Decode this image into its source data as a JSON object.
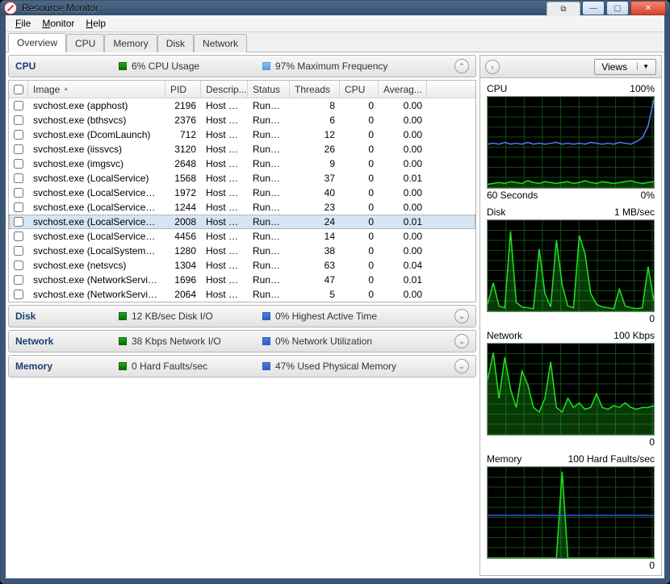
{
  "window": {
    "title": "Resource Monitor"
  },
  "menu": {
    "file": "File",
    "monitor": "Monitor",
    "help": "Help"
  },
  "tabs": [
    "Overview",
    "CPU",
    "Memory",
    "Disk",
    "Network"
  ],
  "active_tab": 0,
  "sections": {
    "cpu": {
      "name": "CPU",
      "m1": "6% CPU Usage",
      "m2": "97% Maximum Frequency",
      "expanded": true
    },
    "disk": {
      "name": "Disk",
      "m1": "12 KB/sec Disk I/O",
      "m2": "0% Highest Active Time",
      "expanded": false
    },
    "network": {
      "name": "Network",
      "m1": "38 Kbps Network I/O",
      "m2": "0% Network Utilization",
      "expanded": false
    },
    "memory": {
      "name": "Memory",
      "m1": "0 Hard Faults/sec",
      "m2": "47% Used Physical Memory",
      "expanded": false
    }
  },
  "columns": [
    "Image",
    "PID",
    "Descrip...",
    "Status",
    "Threads",
    "CPU",
    "Averag..."
  ],
  "processes": [
    {
      "image": "svchost.exe (apphost)",
      "pid": 2196,
      "desc": "Host Pr...",
      "status": "Runni...",
      "threads": 8,
      "cpu": 0,
      "avg": "0.00"
    },
    {
      "image": "svchost.exe (bthsvcs)",
      "pid": 2376,
      "desc": "Host Pr...",
      "status": "Runni...",
      "threads": 6,
      "cpu": 0,
      "avg": "0.00"
    },
    {
      "image": "svchost.exe (DcomLaunch)",
      "pid": 712,
      "desc": "Host Pr...",
      "status": "Runni...",
      "threads": 12,
      "cpu": 0,
      "avg": "0.00"
    },
    {
      "image": "svchost.exe (iissvcs)",
      "pid": 3120,
      "desc": "Host Pr...",
      "status": "Runni...",
      "threads": 26,
      "cpu": 0,
      "avg": "0.00"
    },
    {
      "image": "svchost.exe (imgsvc)",
      "pid": 2648,
      "desc": "Host Pr...",
      "status": "Runni...",
      "threads": 9,
      "cpu": 0,
      "avg": "0.00"
    },
    {
      "image": "svchost.exe (LocalService)",
      "pid": 1568,
      "desc": "Host Pr...",
      "status": "Runni...",
      "threads": 37,
      "cpu": 0,
      "avg": "0.01"
    },
    {
      "image": "svchost.exe (LocalServiceAn...",
      "pid": 1972,
      "desc": "Host Pr...",
      "status": "Runni...",
      "threads": 40,
      "cpu": 0,
      "avg": "0.00"
    },
    {
      "image": "svchost.exe (LocalServiceNet...",
      "pid": 1244,
      "desc": "Host Pr...",
      "status": "Runni...",
      "threads": 23,
      "cpu": 0,
      "avg": "0.00"
    },
    {
      "image": "svchost.exe (LocalServiceNo...",
      "pid": 2008,
      "desc": "Host Pr...",
      "status": "Runni...",
      "threads": 24,
      "cpu": 0,
      "avg": "0.01",
      "selected": true
    },
    {
      "image": "svchost.exe (LocalServicePee...",
      "pid": 4456,
      "desc": "Host Pr...",
      "status": "Runni...",
      "threads": 14,
      "cpu": 0,
      "avg": "0.00"
    },
    {
      "image": "svchost.exe (LocalSystemNet...",
      "pid": 1280,
      "desc": "Host Pr...",
      "status": "Runni...",
      "threads": 38,
      "cpu": 0,
      "avg": "0.00"
    },
    {
      "image": "svchost.exe (netsvcs)",
      "pid": 1304,
      "desc": "Host Pr...",
      "status": "Runni...",
      "threads": 63,
      "cpu": 0,
      "avg": "0.04"
    },
    {
      "image": "svchost.exe (NetworkService)",
      "pid": 1696,
      "desc": "Host Pr...",
      "status": "Runni...",
      "threads": 47,
      "cpu": 0,
      "avg": "0.01"
    },
    {
      "image": "svchost.exe (NetworkService...",
      "pid": 2064,
      "desc": "Host Pr...",
      "status": "Runni...",
      "threads": 5,
      "cpu": 0,
      "avg": "0.00"
    }
  ],
  "right": {
    "views": "Views",
    "graphs": [
      {
        "title": "CPU",
        "right": "100%",
        "footer_l": "60 Seconds",
        "footer_r": "0%"
      },
      {
        "title": "Disk",
        "right": "1 MB/sec",
        "footer_l": "",
        "footer_r": "0"
      },
      {
        "title": "Network",
        "right": "100 Kbps",
        "footer_l": "",
        "footer_r": "0"
      },
      {
        "title": "Memory",
        "right": "100 Hard Faults/sec",
        "footer_l": "",
        "footer_r": "0"
      }
    ]
  },
  "chart_data": [
    {
      "type": "line",
      "title": "CPU",
      "ylim": [
        0,
        100
      ],
      "xlabel": "60 Seconds",
      "ylabel": "%",
      "series": [
        {
          "name": "CPU Usage",
          "color": "#1fe01f",
          "values": [
            4,
            5,
            6,
            5,
            7,
            6,
            5,
            8,
            6,
            5,
            7,
            6,
            5,
            6,
            7,
            5,
            6,
            8,
            6,
            5,
            7,
            6,
            5,
            6,
            7,
            8,
            6,
            5,
            6,
            7
          ]
        },
        {
          "name": "Max Frequency",
          "color": "#4c80ff",
          "values": [
            48,
            49,
            48,
            50,
            48,
            49,
            48,
            50,
            48,
            49,
            48,
            49,
            50,
            48,
            49,
            48,
            49,
            48,
            50,
            49,
            48,
            49,
            48,
            50,
            49,
            48,
            51,
            55,
            68,
            97
          ]
        }
      ]
    },
    {
      "type": "line",
      "title": "Disk",
      "ylim": [
        0,
        1024
      ],
      "ylabel": "KB/sec",
      "series": [
        {
          "name": "Disk I/O",
          "color": "#1fe01f",
          "values": [
            80,
            320,
            60,
            40,
            900,
            100,
            50,
            40,
            30,
            700,
            200,
            50,
            800,
            300,
            60,
            40,
            850,
            650,
            200,
            80,
            50,
            40,
            30,
            250,
            60,
            40,
            30,
            40,
            500,
            120
          ]
        }
      ]
    },
    {
      "type": "line",
      "title": "Network",
      "ylim": [
        0,
        100
      ],
      "ylabel": "Kbps",
      "series": [
        {
          "name": "Network I/O",
          "color": "#1fe01f",
          "values": [
            60,
            90,
            40,
            85,
            50,
            30,
            70,
            55,
            30,
            25,
            40,
            80,
            30,
            25,
            40,
            30,
            35,
            28,
            30,
            45,
            30,
            28,
            32,
            30,
            35,
            30,
            28,
            30,
            30,
            32
          ]
        }
      ]
    },
    {
      "type": "line",
      "title": "Memory",
      "ylim": [
        0,
        100
      ],
      "ylabel": "Hard Faults/sec",
      "series": [
        {
          "name": "Hard Faults",
          "color": "#1fe01f",
          "values": [
            0,
            0,
            0,
            0,
            0,
            0,
            0,
            0,
            0,
            0,
            0,
            0,
            0,
            95,
            0,
            0,
            0,
            0,
            0,
            0,
            0,
            0,
            0,
            0,
            0,
            0,
            0,
            0,
            0,
            0
          ]
        },
        {
          "name": "Used Physical Memory",
          "color": "#3060ff",
          "values": [
            47,
            47,
            47,
            47,
            47,
            47,
            47,
            47,
            47,
            47,
            47,
            47,
            47,
            47,
            47,
            47,
            47,
            47,
            47,
            47,
            47,
            47,
            47,
            47,
            47,
            47,
            47,
            47,
            47,
            47
          ]
        }
      ]
    }
  ]
}
